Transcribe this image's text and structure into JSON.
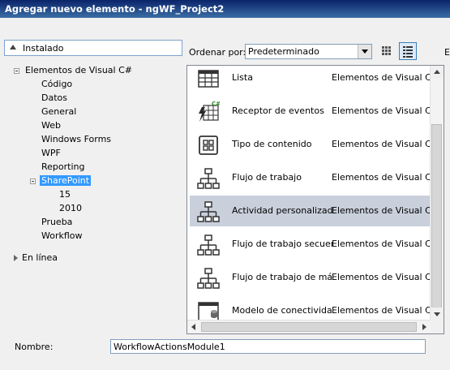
{
  "window": {
    "title": "Agregar nuevo elemento - ngWF_Project2"
  },
  "left": {
    "installed_label": "Instalado",
    "tree": {
      "root_label": "Elementos de Visual C#",
      "children": [
        "Código",
        "Datos",
        "General",
        "Web",
        "Windows Forms",
        "WPF",
        "Reporting",
        "SharePoint"
      ],
      "sharepoint_children": [
        "15",
        "2010"
      ],
      "after": [
        "Prueba",
        "Workflow"
      ],
      "selected": "SharePoint"
    },
    "online_label": "En línea"
  },
  "toolbar": {
    "sort_label": "Ordenar por:",
    "sort_value": "Predeterminado",
    "cutoff_char": "E"
  },
  "items": [
    {
      "name": "Lista",
      "category": "Elementos de Visual C#",
      "icon": "list-grid-icon"
    },
    {
      "name": "Receptor de eventos",
      "category": "Elementos de Visual C#",
      "icon": "event-receiver-icon"
    },
    {
      "name": "Tipo de contenido",
      "category": "Elementos de Visual C#",
      "icon": "content-type-icon"
    },
    {
      "name": "Flujo de trabajo",
      "category": "Elementos de Visual C#",
      "icon": "workflow-icon"
    },
    {
      "name": "Actividad personalizada...",
      "category": "Elementos de Visual C#",
      "icon": "workflow-icon",
      "selected": true
    },
    {
      "name": "Flujo de trabajo secuen...",
      "category": "Elementos de Visual C#",
      "icon": "workflow-icon"
    },
    {
      "name": "Flujo de trabajo de máq...",
      "category": "Elementos de Visual C#",
      "icon": "workflow-icon"
    },
    {
      "name": "Modelo de conectividad...",
      "category": "Elementos de Visual C#",
      "icon": "connectivity-model-icon"
    }
  ],
  "footer": {
    "name_label": "Nombre:",
    "name_value": "WorkflowActionsModule1"
  }
}
